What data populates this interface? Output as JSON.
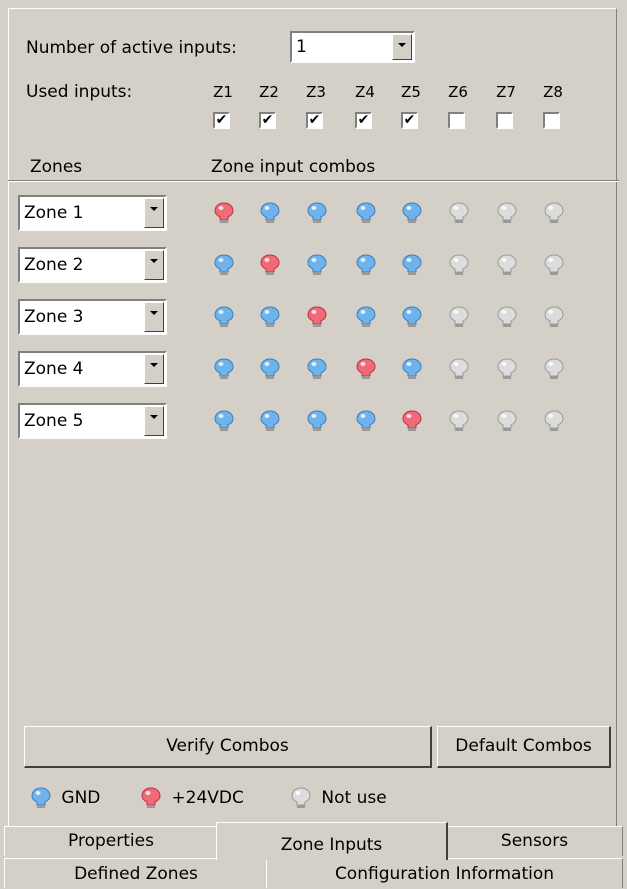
{
  "header": {
    "active_inputs_label": "Number of active inputs:",
    "active_inputs_value": "1",
    "used_inputs_label": "Used inputs:",
    "inputs": [
      {
        "label": "Z1",
        "checked": true
      },
      {
        "label": "Z2",
        "checked": true
      },
      {
        "label": "Z3",
        "checked": true
      },
      {
        "label": "Z4",
        "checked": true
      },
      {
        "label": "Z5",
        "checked": true
      },
      {
        "label": "Z6",
        "checked": false
      },
      {
        "label": "Z7",
        "checked": false
      },
      {
        "label": "Z8",
        "checked": false
      }
    ],
    "zones_col_label": "Zones",
    "combos_col_label": "Zone input combos"
  },
  "zones": [
    {
      "name": "Zone 1",
      "states": [
        "red",
        "blue",
        "blue",
        "blue",
        "blue",
        "gray",
        "gray",
        "gray"
      ]
    },
    {
      "name": "Zone 2",
      "states": [
        "blue",
        "red",
        "blue",
        "blue",
        "blue",
        "gray",
        "gray",
        "gray"
      ]
    },
    {
      "name": "Zone 3",
      "states": [
        "blue",
        "blue",
        "red",
        "blue",
        "blue",
        "gray",
        "gray",
        "gray"
      ]
    },
    {
      "name": "Zone 4",
      "states": [
        "blue",
        "blue",
        "blue",
        "red",
        "blue",
        "gray",
        "gray",
        "gray"
      ]
    },
    {
      "name": "Zone 5",
      "states": [
        "blue",
        "blue",
        "blue",
        "blue",
        "red",
        "gray",
        "gray",
        "gray"
      ]
    }
  ],
  "buttons": {
    "verify": "Verify Combos",
    "default": "Default Combos"
  },
  "legend": {
    "gnd": "GND",
    "v24": "+24VDC",
    "notuse": "Not use"
  },
  "tabs": {
    "row1": [
      "Properties",
      "Zone Inputs",
      "Sensors"
    ],
    "row2": [
      "Defined Zones",
      "Configuration Information"
    ],
    "active": "Zone Inputs"
  },
  "colors": {
    "blue": "#6fb3ec",
    "red": "#f06a78",
    "gray": "#dcdcdc",
    "face": "#d4d0c8"
  }
}
